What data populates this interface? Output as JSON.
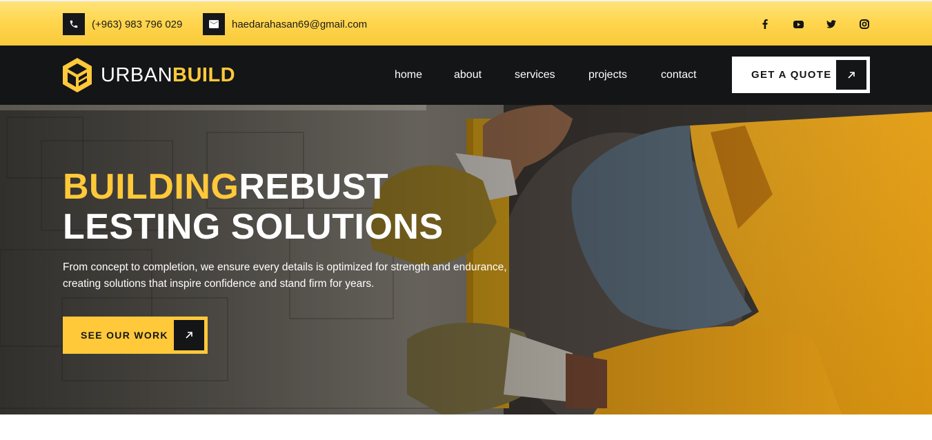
{
  "topbar": {
    "phone": "(+963) 983 796 029",
    "email": "haedarahasan69@gmail.com",
    "icons": [
      "phone-icon",
      "mail-icon",
      "facebook-icon",
      "youtube-icon",
      "twitter-icon",
      "instagram-icon"
    ]
  },
  "brand": {
    "name_part1": "URBAN",
    "name_part2": "BUILD",
    "accent_color": "#ffc93a",
    "dark_color": "#141517"
  },
  "nav": {
    "items": [
      {
        "label": "home"
      },
      {
        "label": "about"
      },
      {
        "label": "services"
      },
      {
        "label": "projects"
      },
      {
        "label": "contact"
      }
    ],
    "cta_label": "GET A QUOTE"
  },
  "hero": {
    "title_highlight": "BUILDING",
    "title_rest": "REBUST",
    "title_line2": "LESTING SOLUTIONS",
    "description_line1": "From concept to completion, we ensure every details is optimized for strength and endurance,",
    "description_line2": "creating solutions that inspire confidence and stand firm for years.",
    "cta_label": "SEE OUR WORK"
  }
}
